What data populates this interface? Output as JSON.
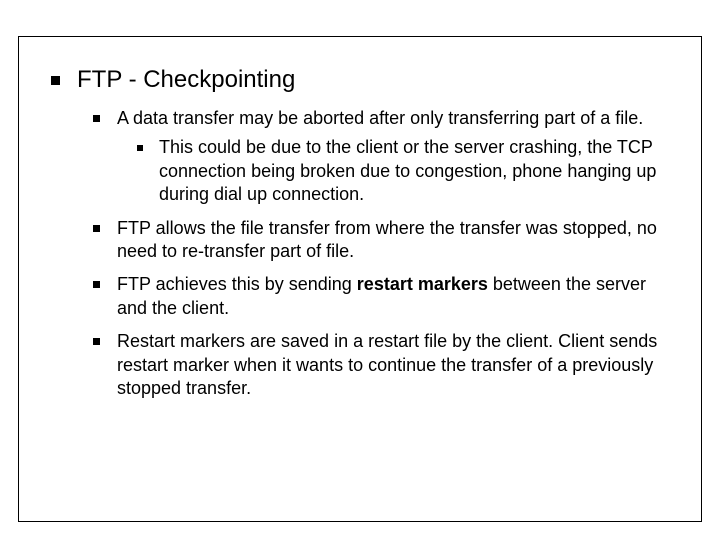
{
  "slide": {
    "title": "FTP - Checkpointing",
    "sub": {
      "0": {
        "text": "A data transfer may be aborted after only transferring part of a file.",
        "sub": {
          "0": "This could be due to the client or the server crashing, the TCP connection being broken due to congestion, phone hanging up during dial up connection."
        }
      },
      "1": "FTP allows the file transfer from where the transfer was stopped, no need to re-transfer part of file.",
      "2_pre": "FTP achieves this by sending ",
      "2_bold": "restart markers",
      "2_post": " between the server and the client.",
      "3": "Restart markers are saved in a restart file by the client. Client sends restart marker when it wants to continue the transfer of a previously stopped transfer."
    }
  }
}
